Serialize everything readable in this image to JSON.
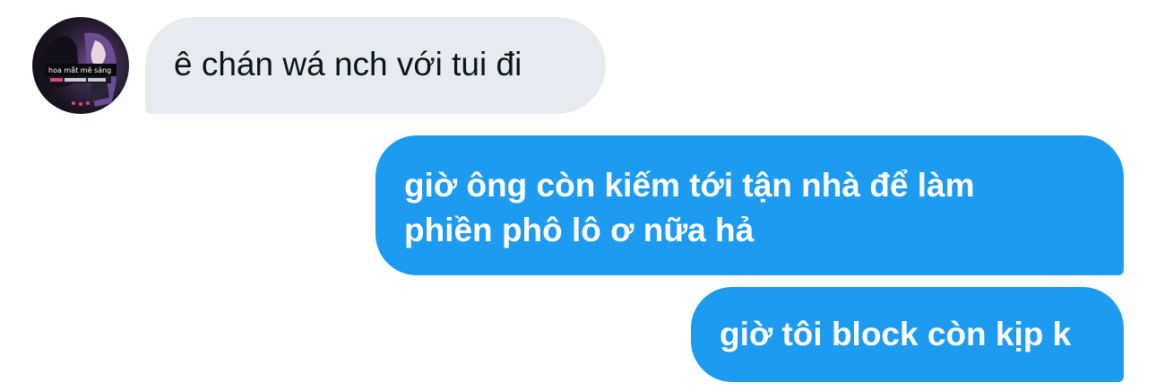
{
  "messages": [
    {
      "direction": "incoming",
      "text": "ê chán wá nch với tui đi"
    },
    {
      "direction": "outgoing",
      "lines": [
        "giờ ông còn kiếm tới tận nhà để làm",
        "phiền phô lô ơ nữa hả"
      ]
    },
    {
      "direction": "outgoing",
      "text": "giờ tôi block còn kịp k"
    }
  ],
  "colors": {
    "incoming_bubble": "#e7ebef",
    "incoming_text": "#0f1419",
    "outgoing_bubble": "#1d9bf0",
    "outgoing_text": "#ffffff"
  },
  "avatar": {
    "icon": "profile-avatar",
    "caption": "hoa mắt mê sảng"
  }
}
